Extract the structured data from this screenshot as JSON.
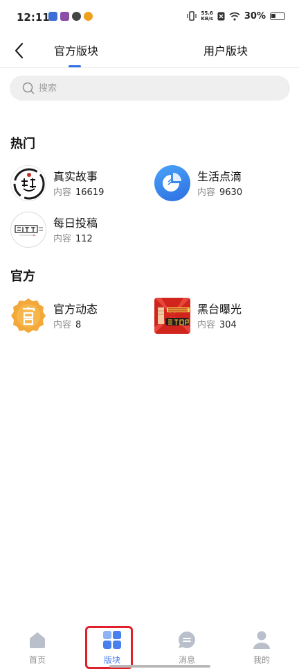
{
  "status_bar": {
    "time": "12:11",
    "net_speed_value": "55.6",
    "net_speed_unit": "KB/s",
    "battery": "30%"
  },
  "header": {
    "tabs": [
      {
        "label": "官方版块",
        "active": true
      },
      {
        "label": "用户版块",
        "active": false
      }
    ],
    "accent_color": "#2f6fe4"
  },
  "search": {
    "placeholder": "搜索"
  },
  "sections": [
    {
      "title": "热门",
      "boards": [
        {
          "name": "真实故事",
          "count_label": "内容",
          "count": "16619",
          "icon": "ink-seal-logo"
        },
        {
          "name": "生活点滴",
          "count_label": "内容",
          "count": "9630",
          "icon": "pie-chart-logo"
        },
        {
          "name": "每日投稿",
          "count_label": "内容",
          "count": "112",
          "icon": "true-story-text-logo"
        }
      ]
    },
    {
      "title": "官方",
      "boards": [
        {
          "name": "官方动态",
          "count_label": "内容",
          "count": "8",
          "icon": "official-badge-logo"
        },
        {
          "name": "黑台曝光",
          "count_label": "内容",
          "count": "304",
          "icon": "stop-fist-logo"
        }
      ]
    }
  ],
  "bottom_nav": {
    "items": [
      {
        "label": "首页",
        "icon": "home-icon",
        "active": false
      },
      {
        "label": "版块",
        "icon": "grid-icon",
        "active": true
      },
      {
        "label": "消息",
        "icon": "message-icon",
        "active": false
      },
      {
        "label": "我的",
        "icon": "profile-icon",
        "active": false
      }
    ],
    "active_color": "#4a7ff0",
    "highlight_color": "#e0202a"
  }
}
